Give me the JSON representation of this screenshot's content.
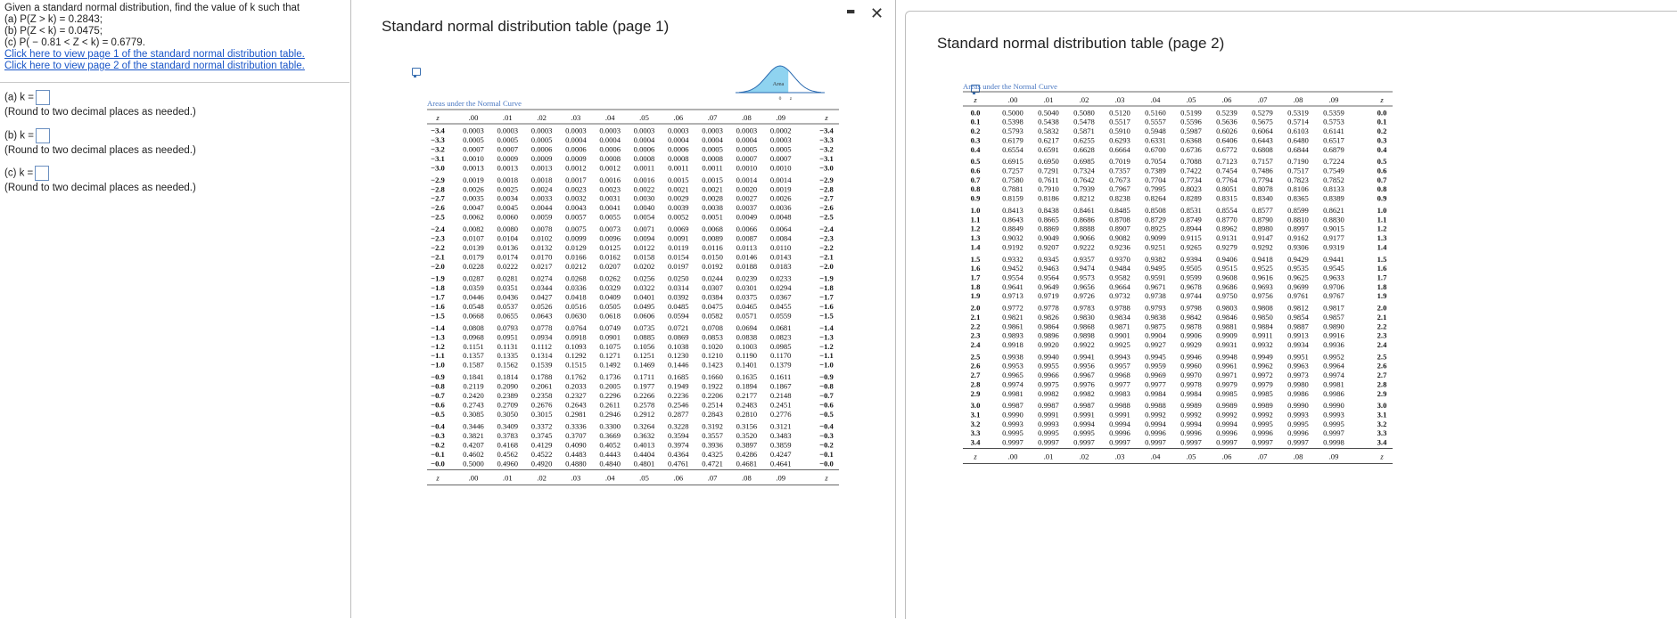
{
  "question": {
    "lines": [
      "Given a standard normal distribution, find the value of k such that",
      "(a) P(Z > k) = 0.2843;",
      "(b) P(Z < k) = 0.0475;",
      "(c) P( − 0.81 < Z < k) = 0.6779."
    ],
    "link1": "Click here to view page 1 of the standard normal distribution table.",
    "link2": "Click here to view page 2 of the standard normal distribution table."
  },
  "answers": [
    {
      "label": "(a) k =",
      "value": "",
      "note": "(Round to two decimal places as needed.)"
    },
    {
      "label": "(b) k =",
      "value": "",
      "note": "(Round to two decimal places as needed.)"
    },
    {
      "label": "(c) k =",
      "value": "",
      "note": "(Round to two decimal places as needed.)"
    }
  ],
  "window1": {
    "title": "Standard normal distribution table (page 1)",
    "minimize_glyph": "▬",
    "close_glyph": "✕",
    "caption": "Areas under the Normal Curve",
    "figure_label": "Area",
    "figure_axis": [
      "0",
      "z"
    ]
  },
  "window2": {
    "title": "Standard normal distribution table (page 2)",
    "caption": "Areas under the Normal Curve"
  },
  "table_cols": [
    ".00",
    ".01",
    ".02",
    ".03",
    ".04",
    ".05",
    ".06",
    ".07",
    ".08",
    ".09"
  ],
  "z_header": "z",
  "table1": [
    [
      "−3.4",
      "0.0003",
      "0.0003",
      "0.0003",
      "0.0003",
      "0.0003",
      "0.0003",
      "0.0003",
      "0.0003",
      "0.0003",
      "0.0002"
    ],
    [
      "−3.3",
      "0.0005",
      "0.0005",
      "0.0005",
      "0.0004",
      "0.0004",
      "0.0004",
      "0.0004",
      "0.0004",
      "0.0004",
      "0.0003"
    ],
    [
      "−3.2",
      "0.0007",
      "0.0007",
      "0.0006",
      "0.0006",
      "0.0006",
      "0.0006",
      "0.0006",
      "0.0005",
      "0.0005",
      "0.0005"
    ],
    [
      "−3.1",
      "0.0010",
      "0.0009",
      "0.0009",
      "0.0009",
      "0.0008",
      "0.0008",
      "0.0008",
      "0.0008",
      "0.0007",
      "0.0007"
    ],
    [
      "−3.0",
      "0.0013",
      "0.0013",
      "0.0013",
      "0.0012",
      "0.0012",
      "0.0011",
      "0.0011",
      "0.0011",
      "0.0010",
      "0.0010"
    ],
    [
      "−2.9",
      "0.0019",
      "0.0018",
      "0.0018",
      "0.0017",
      "0.0016",
      "0.0016",
      "0.0015",
      "0.0015",
      "0.0014",
      "0.0014"
    ],
    [
      "−2.8",
      "0.0026",
      "0.0025",
      "0.0024",
      "0.0023",
      "0.0023",
      "0.0022",
      "0.0021",
      "0.0021",
      "0.0020",
      "0.0019"
    ],
    [
      "−2.7",
      "0.0035",
      "0.0034",
      "0.0033",
      "0.0032",
      "0.0031",
      "0.0030",
      "0.0029",
      "0.0028",
      "0.0027",
      "0.0026"
    ],
    [
      "−2.6",
      "0.0047",
      "0.0045",
      "0.0044",
      "0.0043",
      "0.0041",
      "0.0040",
      "0.0039",
      "0.0038",
      "0.0037",
      "0.0036"
    ],
    [
      "−2.5",
      "0.0062",
      "0.0060",
      "0.0059",
      "0.0057",
      "0.0055",
      "0.0054",
      "0.0052",
      "0.0051",
      "0.0049",
      "0.0048"
    ],
    [
      "−2.4",
      "0.0082",
      "0.0080",
      "0.0078",
      "0.0075",
      "0.0073",
      "0.0071",
      "0.0069",
      "0.0068",
      "0.0066",
      "0.0064"
    ],
    [
      "−2.3",
      "0.0107",
      "0.0104",
      "0.0102",
      "0.0099",
      "0.0096",
      "0.0094",
      "0.0091",
      "0.0089",
      "0.0087",
      "0.0084"
    ],
    [
      "−2.2",
      "0.0139",
      "0.0136",
      "0.0132",
      "0.0129",
      "0.0125",
      "0.0122",
      "0.0119",
      "0.0116",
      "0.0113",
      "0.0110"
    ],
    [
      "−2.1",
      "0.0179",
      "0.0174",
      "0.0170",
      "0.0166",
      "0.0162",
      "0.0158",
      "0.0154",
      "0.0150",
      "0.0146",
      "0.0143"
    ],
    [
      "−2.0",
      "0.0228",
      "0.0222",
      "0.0217",
      "0.0212",
      "0.0207",
      "0.0202",
      "0.0197",
      "0.0192",
      "0.0188",
      "0.0183"
    ],
    [
      "−1.9",
      "0.0287",
      "0.0281",
      "0.0274",
      "0.0268",
      "0.0262",
      "0.0256",
      "0.0250",
      "0.0244",
      "0.0239",
      "0.0233"
    ],
    [
      "−1.8",
      "0.0359",
      "0.0351",
      "0.0344",
      "0.0336",
      "0.0329",
      "0.0322",
      "0.0314",
      "0.0307",
      "0.0301",
      "0.0294"
    ],
    [
      "−1.7",
      "0.0446",
      "0.0436",
      "0.0427",
      "0.0418",
      "0.0409",
      "0.0401",
      "0.0392",
      "0.0384",
      "0.0375",
      "0.0367"
    ],
    [
      "−1.6",
      "0.0548",
      "0.0537",
      "0.0526",
      "0.0516",
      "0.0505",
      "0.0495",
      "0.0485",
      "0.0475",
      "0.0465",
      "0.0455"
    ],
    [
      "−1.5",
      "0.0668",
      "0.0655",
      "0.0643",
      "0.0630",
      "0.0618",
      "0.0606",
      "0.0594",
      "0.0582",
      "0.0571",
      "0.0559"
    ],
    [
      "−1.4",
      "0.0808",
      "0.0793",
      "0.0778",
      "0.0764",
      "0.0749",
      "0.0735",
      "0.0721",
      "0.0708",
      "0.0694",
      "0.0681"
    ],
    [
      "−1.3",
      "0.0968",
      "0.0951",
      "0.0934",
      "0.0918",
      "0.0901",
      "0.0885",
      "0.0869",
      "0.0853",
      "0.0838",
      "0.0823"
    ],
    [
      "−1.2",
      "0.1151",
      "0.1131",
      "0.1112",
      "0.1093",
      "0.1075",
      "0.1056",
      "0.1038",
      "0.1020",
      "0.1003",
      "0.0985"
    ],
    [
      "−1.1",
      "0.1357",
      "0.1335",
      "0.1314",
      "0.1292",
      "0.1271",
      "0.1251",
      "0.1230",
      "0.1210",
      "0.1190",
      "0.1170"
    ],
    [
      "−1.0",
      "0.1587",
      "0.1562",
      "0.1539",
      "0.1515",
      "0.1492",
      "0.1469",
      "0.1446",
      "0.1423",
      "0.1401",
      "0.1379"
    ],
    [
      "−0.9",
      "0.1841",
      "0.1814",
      "0.1788",
      "0.1762",
      "0.1736",
      "0.1711",
      "0.1685",
      "0.1660",
      "0.1635",
      "0.1611"
    ],
    [
      "−0.8",
      "0.2119",
      "0.2090",
      "0.2061",
      "0.2033",
      "0.2005",
      "0.1977",
      "0.1949",
      "0.1922",
      "0.1894",
      "0.1867"
    ],
    [
      "−0.7",
      "0.2420",
      "0.2389",
      "0.2358",
      "0.2327",
      "0.2296",
      "0.2266",
      "0.2236",
      "0.2206",
      "0.2177",
      "0.2148"
    ],
    [
      "−0.6",
      "0.2743",
      "0.2709",
      "0.2676",
      "0.2643",
      "0.2611",
      "0.2578",
      "0.2546",
      "0.2514",
      "0.2483",
      "0.2451"
    ],
    [
      "−0.5",
      "0.3085",
      "0.3050",
      "0.3015",
      "0.2981",
      "0.2946",
      "0.2912",
      "0.2877",
      "0.2843",
      "0.2810",
      "0.2776"
    ],
    [
      "−0.4",
      "0.3446",
      "0.3409",
      "0.3372",
      "0.3336",
      "0.3300",
      "0.3264",
      "0.3228",
      "0.3192",
      "0.3156",
      "0.3121"
    ],
    [
      "−0.3",
      "0.3821",
      "0.3783",
      "0.3745",
      "0.3707",
      "0.3669",
      "0.3632",
      "0.3594",
      "0.3557",
      "0.3520",
      "0.3483"
    ],
    [
      "−0.2",
      "0.4207",
      "0.4168",
      "0.4129",
      "0.4090",
      "0.4052",
      "0.4013",
      "0.3974",
      "0.3936",
      "0.3897",
      "0.3859"
    ],
    [
      "−0.1",
      "0.4602",
      "0.4562",
      "0.4522",
      "0.4483",
      "0.4443",
      "0.4404",
      "0.4364",
      "0.4325",
      "0.4286",
      "0.4247"
    ],
    [
      "−0.0",
      "0.5000",
      "0.4960",
      "0.4920",
      "0.4880",
      "0.4840",
      "0.4801",
      "0.4761",
      "0.4721",
      "0.4681",
      "0.4641"
    ]
  ],
  "table2": [
    [
      "0.0",
      "0.5000",
      "0.5040",
      "0.5080",
      "0.5120",
      "0.5160",
      "0.5199",
      "0.5239",
      "0.5279",
      "0.5319",
      "0.5359"
    ],
    [
      "0.1",
      "0.5398",
      "0.5438",
      "0.5478",
      "0.5517",
      "0.5557",
      "0.5596",
      "0.5636",
      "0.5675",
      "0.5714",
      "0.5753"
    ],
    [
      "0.2",
      "0.5793",
      "0.5832",
      "0.5871",
      "0.5910",
      "0.5948",
      "0.5987",
      "0.6026",
      "0.6064",
      "0.6103",
      "0.6141"
    ],
    [
      "0.3",
      "0.6179",
      "0.6217",
      "0.6255",
      "0.6293",
      "0.6331",
      "0.6368",
      "0.6406",
      "0.6443",
      "0.6480",
      "0.6517"
    ],
    [
      "0.4",
      "0.6554",
      "0.6591",
      "0.6628",
      "0.6664",
      "0.6700",
      "0.6736",
      "0.6772",
      "0.6808",
      "0.6844",
      "0.6879"
    ],
    [
      "0.5",
      "0.6915",
      "0.6950",
      "0.6985",
      "0.7019",
      "0.7054",
      "0.7088",
      "0.7123",
      "0.7157",
      "0.7190",
      "0.7224"
    ],
    [
      "0.6",
      "0.7257",
      "0.7291",
      "0.7324",
      "0.7357",
      "0.7389",
      "0.7422",
      "0.7454",
      "0.7486",
      "0.7517",
      "0.7549"
    ],
    [
      "0.7",
      "0.7580",
      "0.7611",
      "0.7642",
      "0.7673",
      "0.7704",
      "0.7734",
      "0.7764",
      "0.7794",
      "0.7823",
      "0.7852"
    ],
    [
      "0.8",
      "0.7881",
      "0.7910",
      "0.7939",
      "0.7967",
      "0.7995",
      "0.8023",
      "0.8051",
      "0.8078",
      "0.8106",
      "0.8133"
    ],
    [
      "0.9",
      "0.8159",
      "0.8186",
      "0.8212",
      "0.8238",
      "0.8264",
      "0.8289",
      "0.8315",
      "0.8340",
      "0.8365",
      "0.8389"
    ],
    [
      "1.0",
      "0.8413",
      "0.8438",
      "0.8461",
      "0.8485",
      "0.8508",
      "0.8531",
      "0.8554",
      "0.8577",
      "0.8599",
      "0.8621"
    ],
    [
      "1.1",
      "0.8643",
      "0.8665",
      "0.8686",
      "0.8708",
      "0.8729",
      "0.8749",
      "0.8770",
      "0.8790",
      "0.8810",
      "0.8830"
    ],
    [
      "1.2",
      "0.8849",
      "0.8869",
      "0.8888",
      "0.8907",
      "0.8925",
      "0.8944",
      "0.8962",
      "0.8980",
      "0.8997",
      "0.9015"
    ],
    [
      "1.3",
      "0.9032",
      "0.9049",
      "0.9066",
      "0.9082",
      "0.9099",
      "0.9115",
      "0.9131",
      "0.9147",
      "0.9162",
      "0.9177"
    ],
    [
      "1.4",
      "0.9192",
      "0.9207",
      "0.9222",
      "0.9236",
      "0.9251",
      "0.9265",
      "0.9279",
      "0.9292",
      "0.9306",
      "0.9319"
    ],
    [
      "1.5",
      "0.9332",
      "0.9345",
      "0.9357",
      "0.9370",
      "0.9382",
      "0.9394",
      "0.9406",
      "0.9418",
      "0.9429",
      "0.9441"
    ],
    [
      "1.6",
      "0.9452",
      "0.9463",
      "0.9474",
      "0.9484",
      "0.9495",
      "0.9505",
      "0.9515",
      "0.9525",
      "0.9535",
      "0.9545"
    ],
    [
      "1.7",
      "0.9554",
      "0.9564",
      "0.9573",
      "0.9582",
      "0.9591",
      "0.9599",
      "0.9608",
      "0.9616",
      "0.9625",
      "0.9633"
    ],
    [
      "1.8",
      "0.9641",
      "0.9649",
      "0.9656",
      "0.9664",
      "0.9671",
      "0.9678",
      "0.9686",
      "0.9693",
      "0.9699",
      "0.9706"
    ],
    [
      "1.9",
      "0.9713",
      "0.9719",
      "0.9726",
      "0.9732",
      "0.9738",
      "0.9744",
      "0.9750",
      "0.9756",
      "0.9761",
      "0.9767"
    ],
    [
      "2.0",
      "0.9772",
      "0.9778",
      "0.9783",
      "0.9788",
      "0.9793",
      "0.9798",
      "0.9803",
      "0.9808",
      "0.9812",
      "0.9817"
    ],
    [
      "2.1",
      "0.9821",
      "0.9826",
      "0.9830",
      "0.9834",
      "0.9838",
      "0.9842",
      "0.9846",
      "0.9850",
      "0.9854",
      "0.9857"
    ],
    [
      "2.2",
      "0.9861",
      "0.9864",
      "0.9868",
      "0.9871",
      "0.9875",
      "0.9878",
      "0.9881",
      "0.9884",
      "0.9887",
      "0.9890"
    ],
    [
      "2.3",
      "0.9893",
      "0.9896",
      "0.9898",
      "0.9901",
      "0.9904",
      "0.9906",
      "0.9909",
      "0.9911",
      "0.9913",
      "0.9916"
    ],
    [
      "2.4",
      "0.9918",
      "0.9920",
      "0.9922",
      "0.9925",
      "0.9927",
      "0.9929",
      "0.9931",
      "0.9932",
      "0.9934",
      "0.9936"
    ],
    [
      "2.5",
      "0.9938",
      "0.9940",
      "0.9941",
      "0.9943",
      "0.9945",
      "0.9946",
      "0.9948",
      "0.9949",
      "0.9951",
      "0.9952"
    ],
    [
      "2.6",
      "0.9953",
      "0.9955",
      "0.9956",
      "0.9957",
      "0.9959",
      "0.9960",
      "0.9961",
      "0.9962",
      "0.9963",
      "0.9964"
    ],
    [
      "2.7",
      "0.9965",
      "0.9966",
      "0.9967",
      "0.9968",
      "0.9969",
      "0.9970",
      "0.9971",
      "0.9972",
      "0.9973",
      "0.9974"
    ],
    [
      "2.8",
      "0.9974",
      "0.9975",
      "0.9976",
      "0.9977",
      "0.9977",
      "0.9978",
      "0.9979",
      "0.9979",
      "0.9980",
      "0.9981"
    ],
    [
      "2.9",
      "0.9981",
      "0.9982",
      "0.9982",
      "0.9983",
      "0.9984",
      "0.9984",
      "0.9985",
      "0.9985",
      "0.9986",
      "0.9986"
    ],
    [
      "3.0",
      "0.9987",
      "0.9987",
      "0.9987",
      "0.9988",
      "0.9988",
      "0.9989",
      "0.9989",
      "0.9989",
      "0.9990",
      "0.9990"
    ],
    [
      "3.1",
      "0.9990",
      "0.9991",
      "0.9991",
      "0.9991",
      "0.9992",
      "0.9992",
      "0.9992",
      "0.9992",
      "0.9993",
      "0.9993"
    ],
    [
      "3.2",
      "0.9993",
      "0.9993",
      "0.9994",
      "0.9994",
      "0.9994",
      "0.9994",
      "0.9994",
      "0.9995",
      "0.9995",
      "0.9995"
    ],
    [
      "3.3",
      "0.9995",
      "0.9995",
      "0.9995",
      "0.9996",
      "0.9996",
      "0.9996",
      "0.9996",
      "0.9996",
      "0.9996",
      "0.9997"
    ],
    [
      "3.4",
      "0.9997",
      "0.9997",
      "0.9997",
      "0.9997",
      "0.9997",
      "0.9997",
      "0.9997",
      "0.9997",
      "0.9997",
      "0.9998"
    ]
  ]
}
